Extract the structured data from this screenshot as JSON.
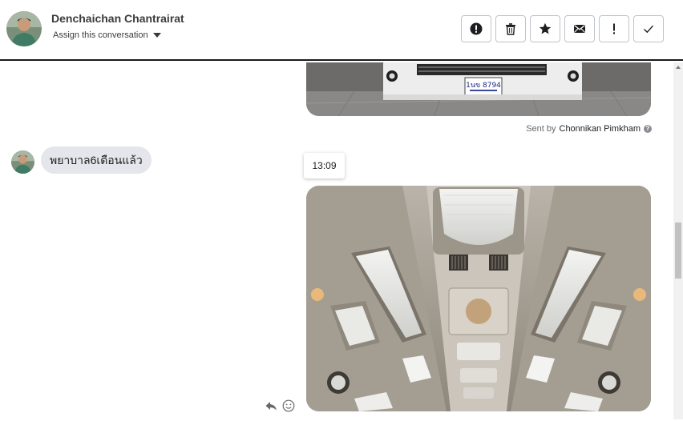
{
  "header": {
    "contact_name": "Denchaichan Chantrairat",
    "assign_label": "Assign this conversation",
    "actions": [
      {
        "icon": "spam-icon"
      },
      {
        "icon": "trash-icon"
      },
      {
        "icon": "star-icon"
      },
      {
        "icon": "mail-icon"
      },
      {
        "icon": "important-icon"
      },
      {
        "icon": "check-icon"
      }
    ]
  },
  "thread": {
    "sent_by_prefix": "Sent by",
    "sent_by_name": "Chonnikan Pimkham",
    "incoming_message": "พยาบาล6เดือนแล้ว",
    "time_tooltip": "13:09",
    "plate_text": "1นข 8794"
  },
  "colors": {
    "bubble_incoming": "#e4e6eb",
    "border": "#bfc3c9",
    "header_divider": "#1a1a1a"
  }
}
